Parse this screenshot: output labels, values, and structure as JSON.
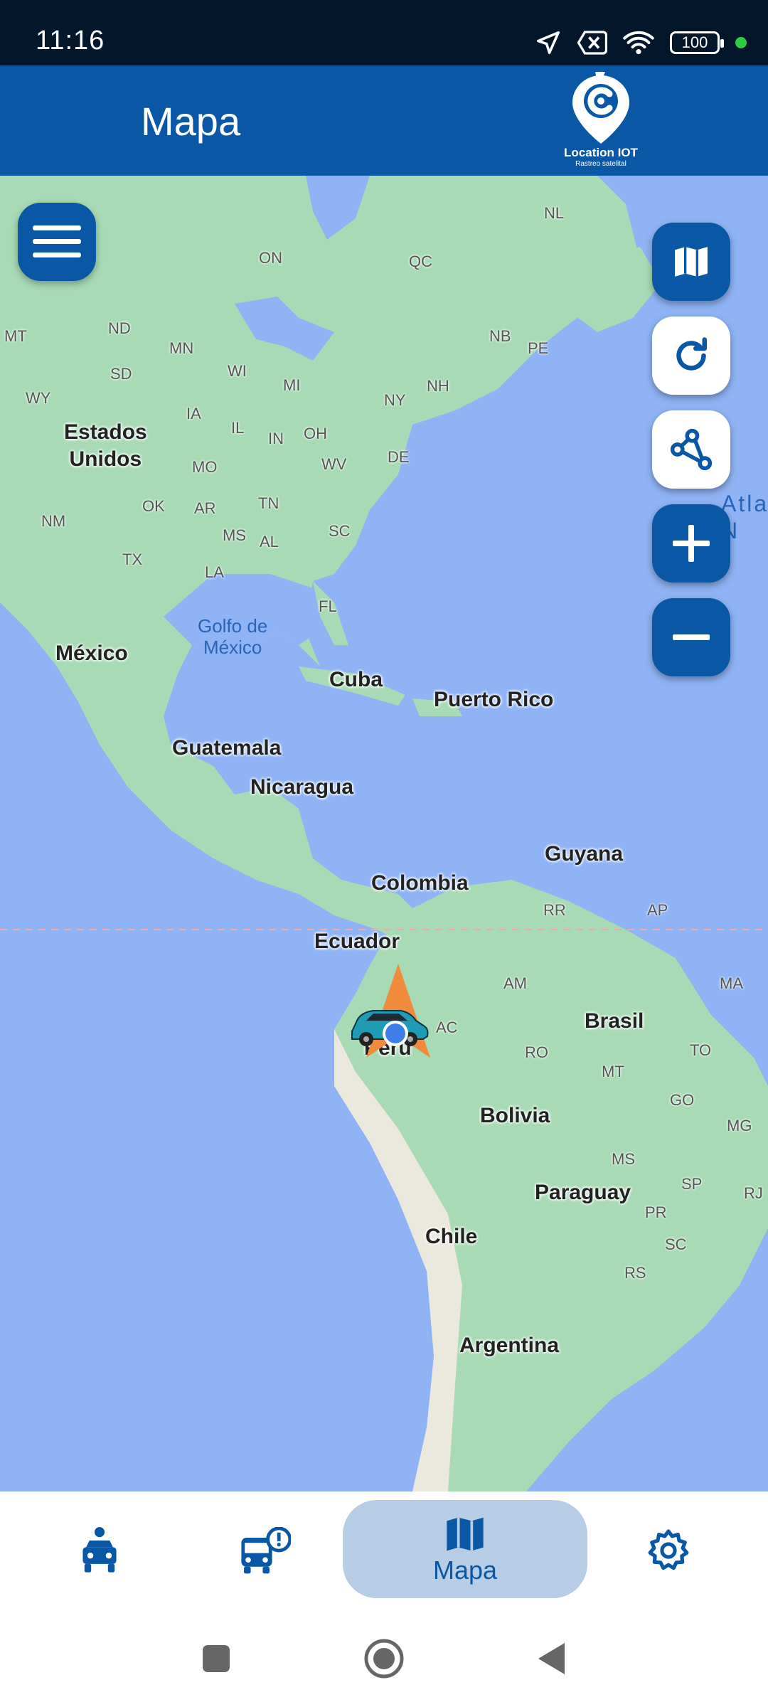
{
  "status_bar": {
    "time": "11:16",
    "battery": "100",
    "icons": [
      "location-arrow-icon",
      "no-sim-icon",
      "wifi-icon",
      "battery-icon",
      "active-dot-icon"
    ]
  },
  "app_bar": {
    "title": "Mapa",
    "logo_title": "Location IOT",
    "logo_subtitle": "Rastreo satelital"
  },
  "map": {
    "countries": [
      {
        "id": "estados-unidos",
        "text": "Estados\nUnidos"
      },
      {
        "id": "mexico",
        "text": "México"
      },
      {
        "id": "cuba",
        "text": "Cuba"
      },
      {
        "id": "puerto-rico",
        "text": "Puerto Rico"
      },
      {
        "id": "guatemala",
        "text": "Guatemala"
      },
      {
        "id": "nicaragua",
        "text": "Nicaragua"
      },
      {
        "id": "guyana",
        "text": "Guyana"
      },
      {
        "id": "colombia",
        "text": "Colombia"
      },
      {
        "id": "ecuador",
        "text": "Ecuador"
      },
      {
        "id": "brasil",
        "text": "Brasil"
      },
      {
        "id": "peru",
        "text": "Perú"
      },
      {
        "id": "bolivia",
        "text": "Bolivia"
      },
      {
        "id": "paraguay",
        "text": "Paraguay"
      },
      {
        "id": "chile",
        "text": "Chile"
      },
      {
        "id": "argentina",
        "text": "Argentina"
      }
    ],
    "regions": [
      "NL",
      "ON",
      "QC",
      "MT",
      "ND",
      "MN",
      "NB",
      "PE",
      "SD",
      "WI",
      "MI",
      "NH",
      "WY",
      "IA",
      "IL",
      "NY",
      "IN",
      "OH",
      "NM",
      "MO",
      "WV",
      "DE",
      "OK",
      "AR",
      "TN",
      "MS",
      "AL",
      "SC",
      "TX",
      "LA",
      "FL",
      "RR",
      "AP",
      "AM",
      "MA",
      "AC",
      "RO",
      "TO",
      "MT",
      "GO",
      "MG",
      "MS",
      "SP",
      "RJ",
      "PR",
      "SC",
      "RS"
    ],
    "water": {
      "gulf": "Golfo de\nMéxico",
      "ocean": "Atla\nN"
    },
    "controls": [
      "map-layers-icon",
      "refresh-icon",
      "route-share-icon",
      "zoom-in-icon",
      "zoom-out-icon"
    ],
    "colors": {
      "water": "#8fb3f4",
      "land": "#a8dab5",
      "mountains": "#ebe8dd",
      "marker": "#f08a3c"
    }
  },
  "bottom_nav": {
    "items": [
      {
        "id": "vehicles",
        "icon": "car-person-icon"
      },
      {
        "id": "alerts",
        "icon": "bus-alert-icon"
      },
      {
        "id": "map",
        "icon": "map-icon",
        "label": "Mapa",
        "active": true
      },
      {
        "id": "settings",
        "icon": "settings-icon"
      }
    ]
  },
  "theme": {
    "primary": "#0a58a5",
    "pill": "#b7cde6"
  }
}
